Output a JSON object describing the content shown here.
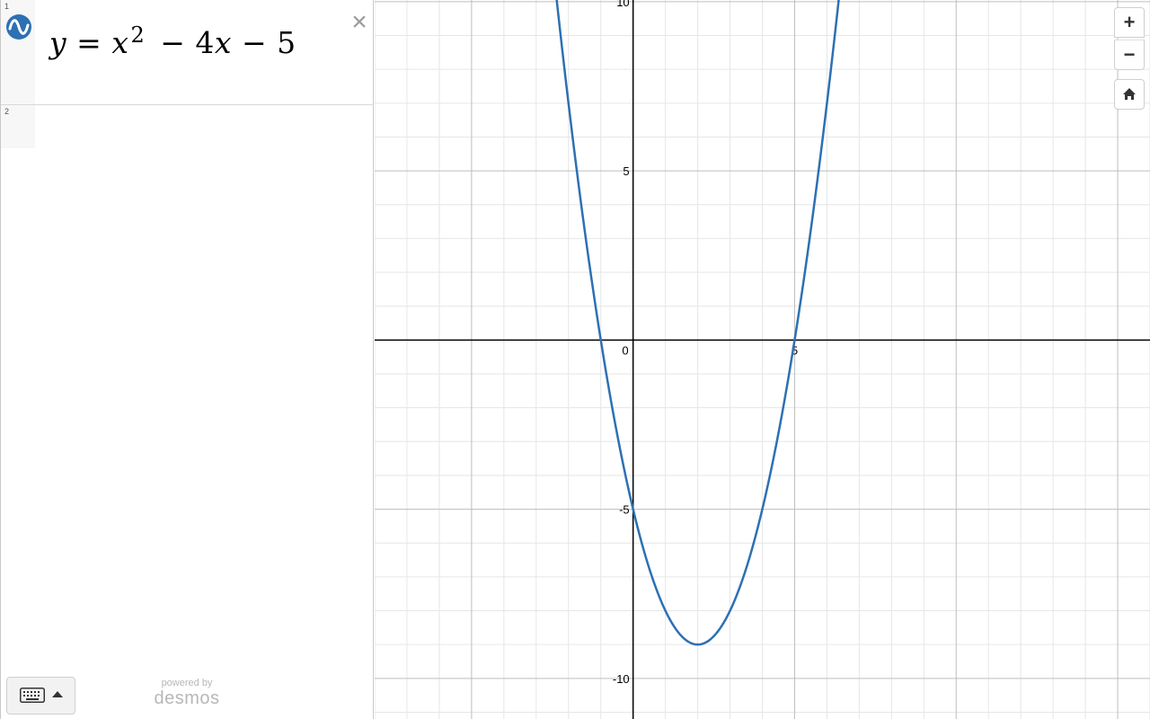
{
  "expressions": [
    {
      "index": "1",
      "lhs": "y",
      "eq": "=",
      "base": "x",
      "exp": "2",
      "rest1": "− 4",
      "var": "x",
      "rest2": "− 5",
      "color": "#2d70b3"
    },
    {
      "index": "2"
    }
  ],
  "delete_symbol": "×",
  "branding": {
    "line1": "powered by",
    "line2": "desmos"
  },
  "controls": {
    "zoom_in": "+",
    "zoom_out": "−"
  },
  "chart_data": {
    "type": "line",
    "title": "",
    "xlabel": "",
    "ylabel": "",
    "xlim": [
      -8.0,
      16.0
    ],
    "ylim": [
      -11.2,
      10.05
    ],
    "grid": true,
    "minor_step": 1,
    "major_step": 5,
    "x_ticks": [
      "5"
    ],
    "y_ticks": [
      "10",
      "5",
      "-5",
      "-10"
    ],
    "origin_label": "0",
    "series": [
      {
        "expression": "y=x^2-4x-5",
        "color": "#2d70b3",
        "coeffs": [
          1,
          -4,
          -5
        ]
      }
    ]
  }
}
